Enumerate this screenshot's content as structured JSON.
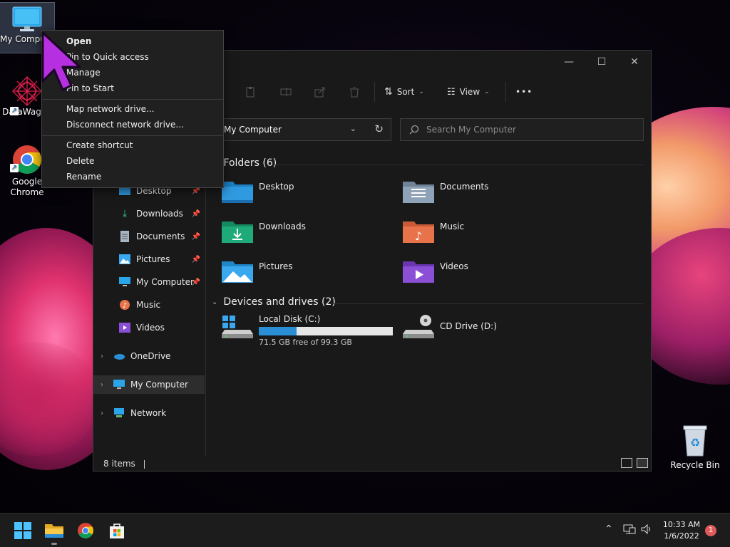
{
  "desktop": {
    "icons": [
      {
        "label": "My Computer",
        "icon": "monitor-icon"
      },
      {
        "label": "DataWagon",
        "icon": "datawagon-icon"
      },
      {
        "label": "Google Chrome",
        "icon": "chrome-icon"
      },
      {
        "label": "Recycle Bin",
        "icon": "recycle-bin-icon"
      }
    ]
  },
  "context_menu": {
    "items": [
      "Open",
      "Pin to Quick access",
      "Manage",
      "Pin to Start",
      "Map network drive...",
      "Disconnect network drive...",
      "Create shortcut",
      "Delete",
      "Rename"
    ]
  },
  "explorer": {
    "window_controls": [
      "minimize",
      "maximize",
      "close"
    ],
    "toolbar": {
      "sort_label": "Sort",
      "view_label": "View",
      "more": "•••"
    },
    "address": "My Computer",
    "search_placeholder": "Search My Computer",
    "nav": {
      "quick": [
        {
          "label": "Desktop",
          "icon": "desktop-folder-icon"
        },
        {
          "label": "Downloads",
          "icon": "downloads-icon"
        },
        {
          "label": "Documents",
          "icon": "documents-icon"
        },
        {
          "label": "Pictures",
          "icon": "pictures-icon"
        },
        {
          "label": "My Computer",
          "icon": "monitor-icon"
        },
        {
          "label": "Music",
          "icon": "music-icon"
        },
        {
          "label": "Videos",
          "icon": "videos-icon"
        }
      ],
      "roots": [
        {
          "label": "OneDrive",
          "icon": "cloud-icon"
        },
        {
          "label": "My Computer",
          "icon": "monitor-icon"
        },
        {
          "label": "Network",
          "icon": "network-icon"
        }
      ]
    },
    "folders_header": "Folders (6)",
    "folders": [
      {
        "label": "Desktop",
        "icon": "desktop-folder-icon",
        "color": "#2f9ae0"
      },
      {
        "label": "Documents",
        "icon": "documents-folder-icon",
        "color": "#8fa3b8"
      },
      {
        "label": "Downloads",
        "icon": "downloads-folder-icon",
        "color": "#1faa7a"
      },
      {
        "label": "Music",
        "icon": "music-folder-icon",
        "color": "#e8734a"
      },
      {
        "label": "Pictures",
        "icon": "pictures-folder-icon",
        "color": "#3aa8ee"
      },
      {
        "label": "Videos",
        "icon": "videos-folder-icon",
        "color": "#8b4fd6"
      }
    ],
    "drives_header": "Devices and drives (2)",
    "drives": [
      {
        "label": "Local Disk (C:)",
        "free_text": "71.5 GB free of 99.3 GB",
        "used_fraction": 0.28
      },
      {
        "label": "CD Drive (D:)"
      }
    ],
    "status": "8 items"
  },
  "taskbar": {
    "apps": [
      "start-icon",
      "file-explorer-icon",
      "chrome-icon",
      "store-icon"
    ],
    "time": "10:33 AM",
    "date": "1/6/2022",
    "notifications": "1"
  }
}
